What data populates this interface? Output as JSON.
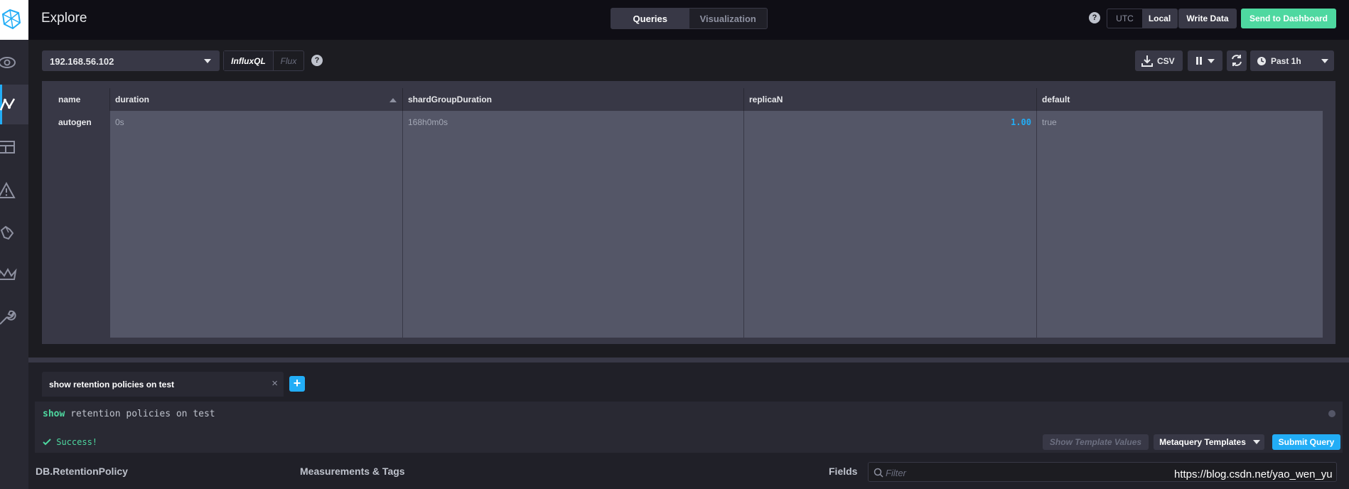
{
  "header": {
    "title": "Explore",
    "tabs": [
      {
        "label": "Queries",
        "active": true
      },
      {
        "label": "Visualization",
        "active": false
      }
    ],
    "help": "?",
    "timezone": {
      "options": [
        "UTC",
        "Local"
      ],
      "selected": "Local"
    },
    "write_data": "Write Data",
    "send_to_dashboard": "Send to Dashboard"
  },
  "sidebar": {
    "items": [
      {
        "icon": "eye-icon"
      },
      {
        "icon": "graph-icon",
        "active": true
      },
      {
        "icon": "table-icon"
      },
      {
        "icon": "alert-triangle-icon"
      },
      {
        "icon": "hand-icon"
      },
      {
        "icon": "crown-icon"
      },
      {
        "icon": "wrench-icon"
      }
    ]
  },
  "toolbar": {
    "source": "192.168.56.102",
    "languages": [
      "InfluxQL",
      "Flux"
    ],
    "selected_language": "InfluxQL",
    "help": "?",
    "csv": "CSV",
    "time_range": "Past 1h"
  },
  "results": {
    "columns": [
      "name",
      "duration",
      "shardGroupDuration",
      "replicaN",
      "default"
    ],
    "sorted_column": "duration",
    "rows": [
      {
        "name": "autogen",
        "duration": "0s",
        "shardGroupDuration": "168h0m0s",
        "replicaN": "1.00",
        "default": "true"
      }
    ]
  },
  "query": {
    "tab_title": "show retention policies on test",
    "add_tab": "+",
    "close": "×",
    "keyword": "show",
    "text": " retention policies on test",
    "status": "Success!",
    "show_template_values": "Show Template Values",
    "metaquery_templates": "Metaquery Templates",
    "submit": "Submit Query"
  },
  "schema": {
    "db_label": "DB.RetentionPolicy",
    "measurements_label": "Measurements & Tags",
    "fields_label": "Fields",
    "filter_placeholder": "Filter"
  },
  "watermark": "https://blog.csdn.net/yao_wen_yu",
  "colors": {
    "accent_blue": "#22adf6",
    "success_green": "#4ed8a0",
    "background": "#1c1c21"
  }
}
